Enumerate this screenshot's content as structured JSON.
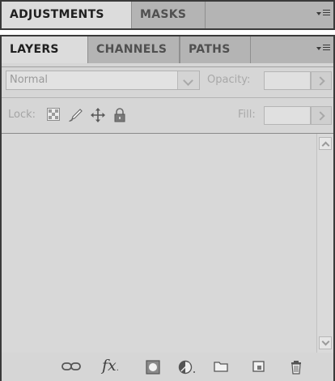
{
  "top_panel": {
    "tabs": [
      {
        "label": "ADJUSTMENTS",
        "active": true
      },
      {
        "label": "MASKS",
        "active": false
      }
    ],
    "menu_icon": "panel-menu-icon"
  },
  "layers_panel": {
    "tabs": [
      {
        "label": "LAYERS",
        "active": true
      },
      {
        "label": "CHANNELS",
        "active": false
      },
      {
        "label": "PATHS",
        "active": false
      }
    ],
    "menu_icon": "panel-menu-icon",
    "blend_mode": {
      "value": "Normal"
    },
    "opacity": {
      "label": "Opacity:",
      "value": ""
    },
    "lock": {
      "label": "Lock:",
      "icons": [
        "lock-transparent-pixels-icon",
        "lock-image-pixels-icon",
        "lock-position-icon",
        "lock-all-icon"
      ]
    },
    "fill": {
      "label": "Fill:",
      "value": ""
    },
    "bottom_icons": [
      "link-layers-icon",
      "fx-icon",
      "layer-mask-icon",
      "adjustment-layer-icon",
      "folder-icon",
      "new-layer-icon",
      "trash-icon"
    ],
    "fx_text": "fx"
  },
  "colors": {
    "panel_bg": "#d6d6d6",
    "tabbar_bg": "#b4b4b4",
    "border_dark": "#3a3a3a"
  }
}
